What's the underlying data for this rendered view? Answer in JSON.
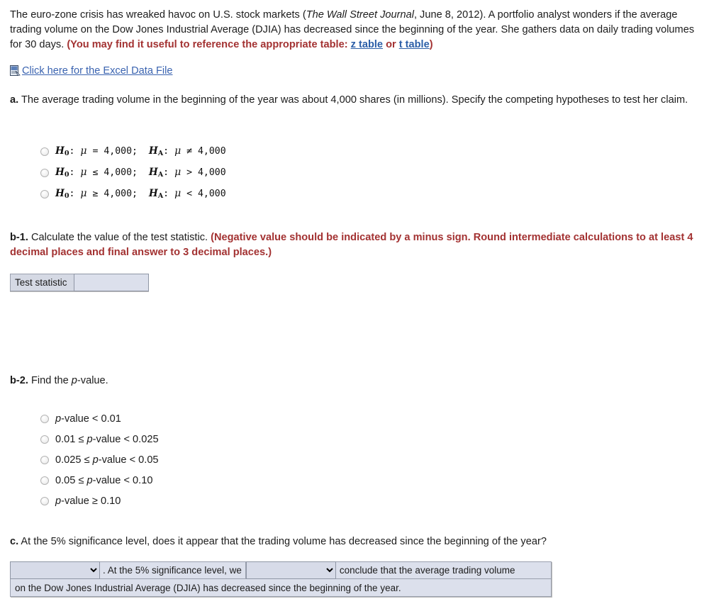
{
  "intro": {
    "part1": "The euro-zone crisis has wreaked havoc on U.S. stock markets (",
    "journal": "The Wall Street Journal",
    "part2": ", June 8, 2012). A portfolio analyst wonders if the average trading volume on the Dow Jones Industrial Average (DJIA) has decreased since the beginning of the year. She gathers data on daily trading volumes for 30 days. ",
    "hint_prefix": "(You may find it useful to reference the appropriate table: ",
    "z_table": "z table",
    "hint_or": " or ",
    "t_table": "t table",
    "hint_suffix": ")"
  },
  "excel": {
    "icon": "excel-document-icon",
    "link_label": "Click here for the Excel Data File"
  },
  "part_a": {
    "marker": "a.",
    "text": " The average trading volume in the beginning of the year was about 4,000 shares (in millions). Specify the competing hypotheses to test her claim.",
    "options": [
      {
        "null_rel": "=",
        "alt_rel": "≠",
        "value": "4,000",
        "full": "H0: μ = 4,000; HA: μ ≠ 4,000"
      },
      {
        "null_rel": "≤",
        "alt_rel": ">",
        "value": "4,000",
        "full": "H0: μ ≤ 4,000; HA: μ > 4,000"
      },
      {
        "null_rel": "≥",
        "alt_rel": "<",
        "value": "4,000",
        "full": "H0: μ ≥ 4,000; HA: μ < 4,000"
      }
    ]
  },
  "part_b1": {
    "marker": "b-1.",
    "text": " Calculate the value of the test statistic. ",
    "red_note": "(Negative value should be indicated by a minus sign. Round intermediate calculations to at least 4 decimal places and final answer to 3 decimal places.)",
    "field_label": "Test statistic",
    "field_value": "",
    "field_placeholder": ""
  },
  "part_b2": {
    "marker": "b-2.",
    "text_before": " Find the ",
    "text_italic": "p",
    "text_after": "-value.",
    "options": [
      "p-value < 0.01",
      "0.01 ≤ p-value < 0.025",
      "0.025 ≤ p-value < 0.05",
      "0.05 ≤ p-value < 0.10",
      "p-value ≥ 0.10"
    ]
  },
  "part_c": {
    "marker": "c.",
    "text": " At the 5% significance level, does it appear that the trading volume has decreased since the beginning of the year?",
    "dropdown1_value": "",
    "segment1": ". At the 5% significance level, we",
    "dropdown2_value": "",
    "segment2": "conclude that the average trading volume",
    "segment3": "on the Dow Jones Industrial Average (DJIA) has decreased since the beginning of the year."
  },
  "colors": {
    "red_note": "#a33232",
    "link_blue": "#3a63b0",
    "table_link_blue": "#2c5fa8",
    "field_fill": "#dce0ec",
    "label_fill": "#d5d9e4",
    "border_gray": "#9aa0ae",
    "cursor_blue": "#4a78c8",
    "text": "#1c1c1c",
    "background": "#ffffff"
  }
}
